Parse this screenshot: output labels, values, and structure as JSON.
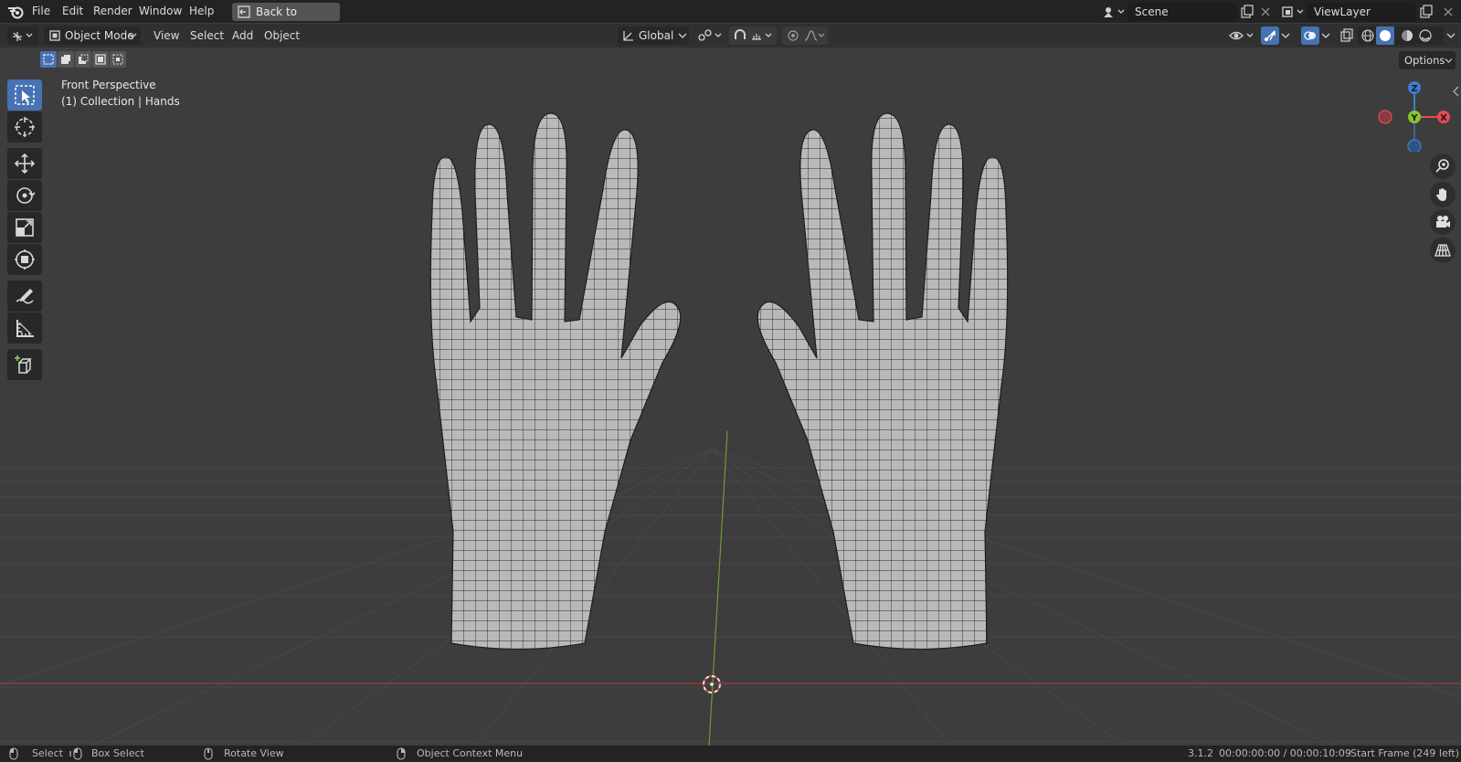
{
  "top_menu": {
    "items": [
      "File",
      "Edit",
      "Render",
      "Window",
      "Help"
    ],
    "back_button": "Back to Previous",
    "scene_name": "Scene",
    "view_layer": "ViewLayer"
  },
  "header": {
    "mode": "Object Mode",
    "menus": [
      "View",
      "Select",
      "Add",
      "Object"
    ],
    "transform_orientation": "Global",
    "options_label": "Options"
  },
  "viewport": {
    "view_name": "Front Perspective",
    "collection_info": "(1) Collection | Hands",
    "gizmo_axes": [
      "Z",
      "Y",
      "X"
    ]
  },
  "toolbar": {
    "tools": [
      "select-box",
      "cursor",
      "move",
      "rotate",
      "scale",
      "transform",
      "annotate",
      "measure",
      "add-cube"
    ],
    "active_tool": "select-box"
  },
  "status_bar": {
    "select": "Select",
    "box_select": "Box Select",
    "rotate_view": "Rotate View",
    "context_menu": "Object Context Menu",
    "version": "3.1.2",
    "time": "00:00:00:00 / 00:00:10:09",
    "frame": "Start Frame (249 left)"
  },
  "colors": {
    "topbar": "#232323",
    "header": "#303030",
    "viewport": "#3d3d3d",
    "accent": "#4772b3",
    "x_axis": "#e64a55",
    "y_axis": "#8ac432",
    "z_axis": "#3b7fd1"
  }
}
